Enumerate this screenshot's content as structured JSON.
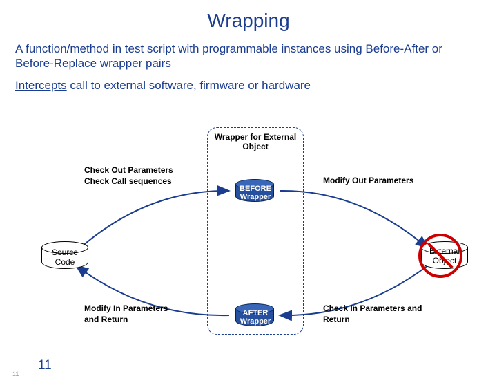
{
  "title": "Wrapping",
  "desc1": "A function/method in test script with programmable instances using Before-After or Before-Replace wrapper pairs",
  "desc2_pre": "",
  "desc2_u": "Intercepts",
  "desc2_post": " call to external software, firmware or hardware",
  "wrapper_box_label": "Wrapper for External Object",
  "before_label": "BEFORE Wrapper",
  "after_label": "AFTER Wrapper",
  "source_label": "Source Code",
  "external_label": "External Object",
  "top_left_text": "Check Out Parameters\nCheck Call sequences",
  "top_right_text": "Modify Out Parameters",
  "bottom_left_text": "Modify In Parameters\nand Return",
  "bottom_right_text": "Check In Parameters and Return",
  "page_number": "11",
  "colors": {
    "brand": "#1a3d8f",
    "forbid": "#c00",
    "wrapper_fill": "#264f9e"
  }
}
